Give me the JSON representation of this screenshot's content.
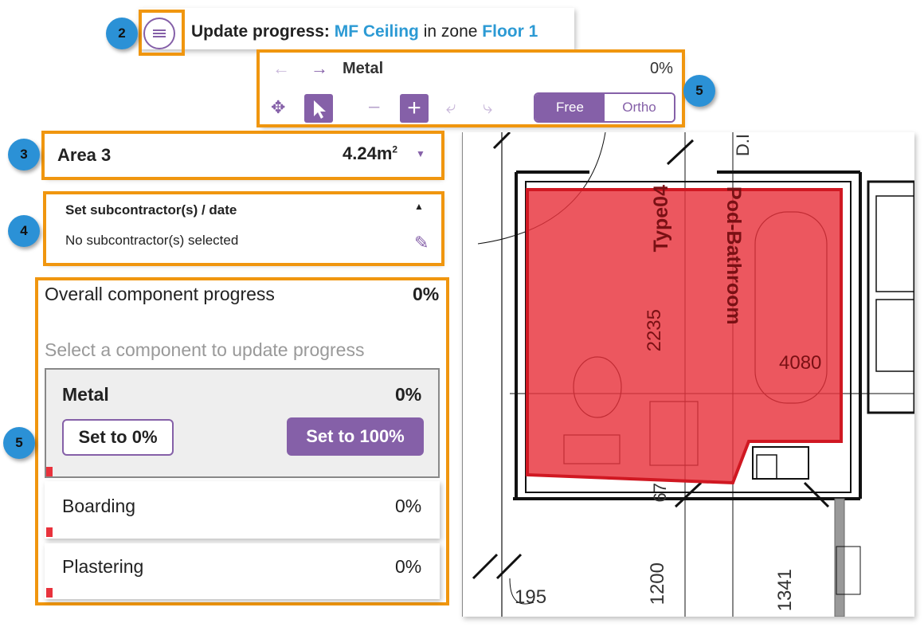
{
  "header": {
    "title_prefix": "Update progress:",
    "component": "MF Ceiling",
    "zone_prefix": "in zone",
    "zone": "Floor 1"
  },
  "toolbar": {
    "layer_name": "Metal",
    "layer_progress": "0%",
    "mode_free": "Free",
    "mode_ortho": "Ortho",
    "minus": "–",
    "plus": "+"
  },
  "area": {
    "name": "Area 3",
    "size": "4.24m",
    "size_sup": "2"
  },
  "subcontractor": {
    "title": "Set subcontractor(s) / date",
    "status": "No subcontractor(s) selected"
  },
  "progress": {
    "title": "Overall component progress",
    "value": "0%",
    "hint": "Select a component to update progress",
    "components": [
      {
        "name": "Metal",
        "value": "0%",
        "btn_zero": "Set to 0%",
        "btn_full": "Set to 100%"
      },
      {
        "name": "Boarding",
        "value": "0%"
      },
      {
        "name": "Plastering",
        "value": "0%"
      }
    ]
  },
  "badges": {
    "b2": "2",
    "b3": "3",
    "b4": "4",
    "b5_left": "5",
    "b5_toolbar": "5"
  },
  "drawing_labels": {
    "room_name_1": "Pod-Bathroom",
    "room_name_2": "Type04",
    "dim_a": "2235",
    "dim_b": "4080",
    "dim_c": "67",
    "dim_d": "195",
    "dim_e": "1200",
    "dim_f": "1341",
    "dim_g": "D.I"
  },
  "colors": {
    "accent": "#8560a8",
    "link": "#2c9ad4",
    "highlight": "#f0960f",
    "badge": "#2b91d6",
    "area_fill": "#e8323c"
  }
}
